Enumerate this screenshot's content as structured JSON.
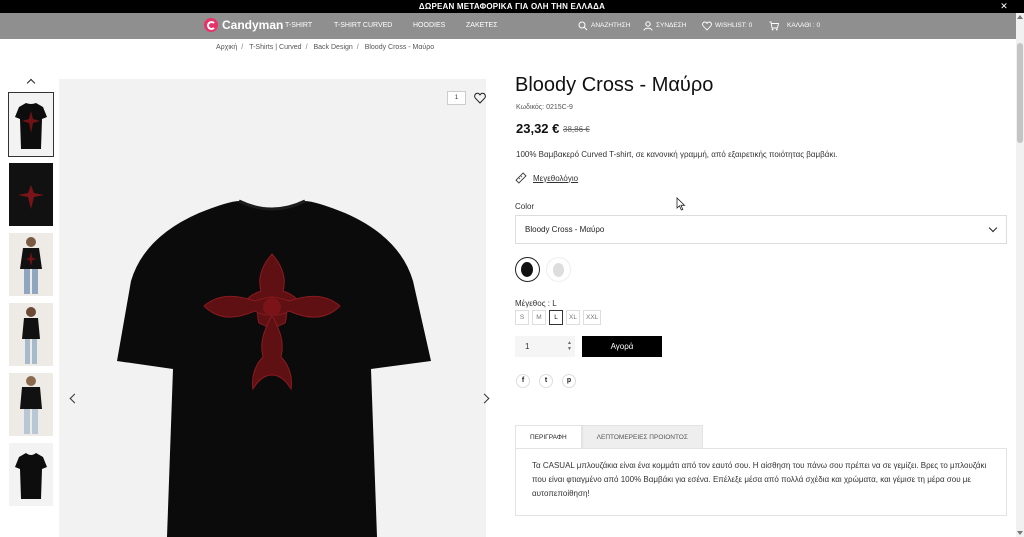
{
  "promo": {
    "text": "ΔΩΡΕΑΝ ΜΕΤΑΦΟΡΙΚΑ ΓΙΑ ΟΛΗ ΤΗΝ ΕΛΛΑΔΑ",
    "close": "✕"
  },
  "header": {
    "logo": "Candyman",
    "menu": [
      "T-SHIRT",
      "T-SHIRT CURVED",
      "HOODIES",
      "ΖΑΚΕΤΕΣ"
    ],
    "search": "ΑΝΑΖΗΤΗΣΗ",
    "login": "ΣΥΝΔΕΣΗ",
    "wishlist": "WISHLIST: 0",
    "cart": "ΚΑΛΑΘΙ : 0"
  },
  "breadcrumb": [
    "Αρχική",
    "T-Shirts | Curved",
    "Back Design",
    "Bloody Cross - Μαύρο"
  ],
  "gallery": {
    "counter": "1"
  },
  "product": {
    "title": "Bloody Cross - Μαύρο",
    "sku": "Κωδικός: 0215C-9",
    "price": "23,32 €",
    "old_price": "38,86 €",
    "description": "100% Βαμβακερό Curved T-shirt, σε κανονική γραμμή, από εξαιρετικής ποιότητας βαμβάκι.",
    "size_guide": "Μεγεθολόγιο",
    "color_label": "Color",
    "color_value": "Bloody Cross - Μαύρο",
    "size_label": "Μέγεθος : L",
    "sizes": [
      "S",
      "M",
      "L",
      "XL",
      "XXL"
    ],
    "quantity": "1",
    "buy_label": "Αγορά"
  },
  "social": [
    "f",
    "t",
    "p"
  ],
  "tabs": {
    "description": "ΠΕΡΙΓΡΑΦΗ",
    "details": "ΛΕΠΤΟΜΕΡΕΙΕΣ ΠΡΟΙΟΝΤΟΣ",
    "body": "Τα CASUAL μπλουζάκια είναι ένα κομμάτι από τον εαυτό σου. Η αίσθηση του πάνω σου πρέπει να σε γεμίζει. Βρες το μπλουζάκι που είναι φτιαγμένο από 100% Βαμβάκι για εσένα. Επέλεξε μέσα από πολλά σχέδια και χρώματα, και γέμισε τη μέρα σου με αυτοπεποίθηση!"
  },
  "colors": {
    "nav_bg": "#8f8f8f",
    "brand": "#e8336a",
    "accent_print": "#7a1418"
  }
}
